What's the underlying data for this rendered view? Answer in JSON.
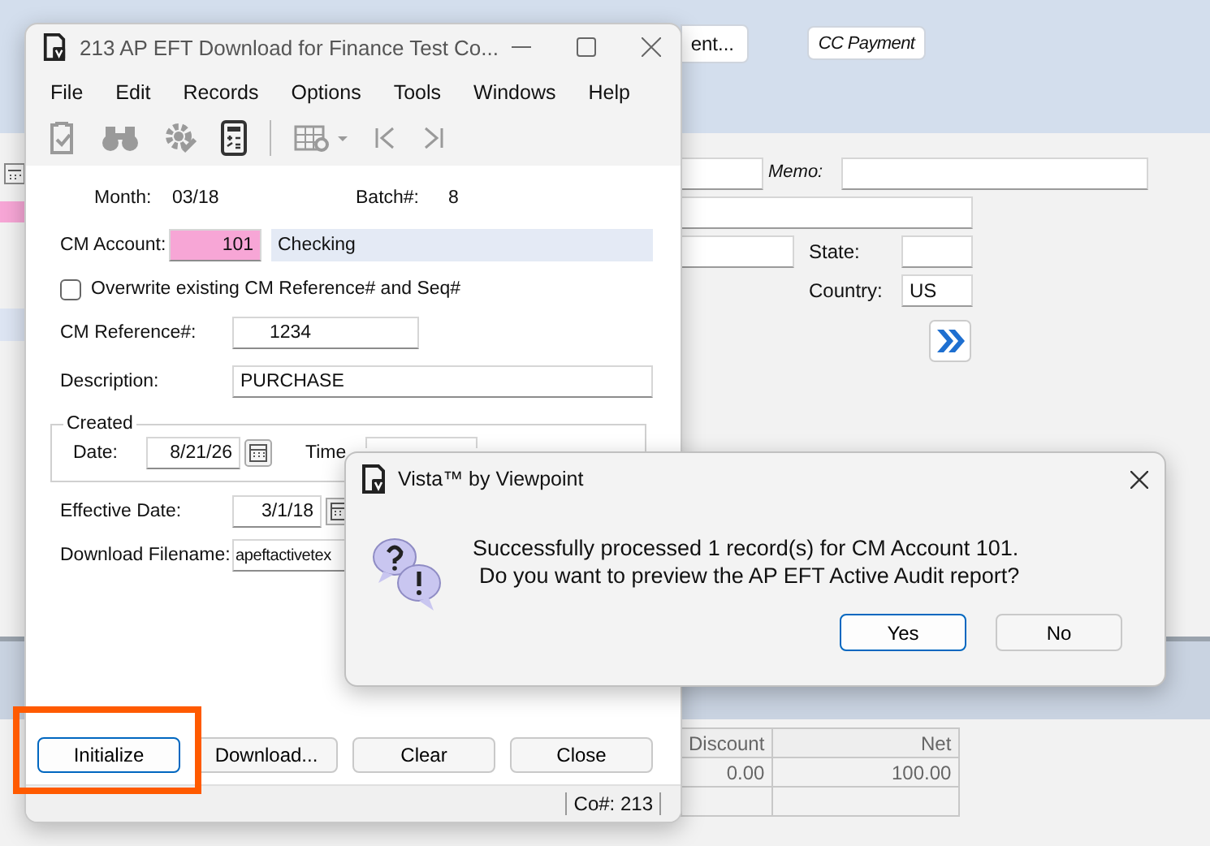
{
  "background_form": {
    "top_buttons": [
      {
        "label": "ent..."
      },
      {
        "label": "CC Payment"
      }
    ],
    "memo_label": "Memo:",
    "state_label": "State:",
    "country_label": "Country:",
    "country_value": "US",
    "grid": {
      "columns": [
        "Discount",
        "Net"
      ],
      "rows": [
        [
          "0.00",
          "100.00"
        ]
      ]
    }
  },
  "window": {
    "title": "213 AP EFT Download for Finance Test Co...",
    "menu": [
      "File",
      "Edit",
      "Records",
      "Options",
      "Tools",
      "Windows",
      "Help"
    ],
    "toolbar": [
      {
        "kind": "clipboard",
        "disabled": true
      },
      {
        "kind": "binoculars",
        "disabled": true
      },
      {
        "kind": "gear",
        "disabled": true
      },
      {
        "kind": "calculator",
        "disabled": false
      },
      {
        "kind": "grid",
        "disabled": true
      },
      {
        "kind": "first",
        "disabled": true
      },
      {
        "kind": "last",
        "disabled": true
      }
    ],
    "month": {
      "label": "Month:",
      "value": "03/18"
    },
    "batch": {
      "label": "Batch#:",
      "value": "8"
    },
    "cm_account": {
      "label": "CM Account:",
      "value": "101",
      "description": "Checking"
    },
    "overwrite": {
      "label": "Overwrite existing CM Reference# and Seq#",
      "checked": false
    },
    "cm_reference": {
      "label": "CM Reference#:",
      "value": "1234"
    },
    "description": {
      "label": "Description:",
      "value": "PURCHASE"
    },
    "created": {
      "title": "Created",
      "date_label": "Date:",
      "date_value": "8/21/26",
      "time_label": "Time"
    },
    "effective_date": {
      "label": "Effective Date:",
      "value": "3/1/18"
    },
    "download_filename": {
      "label": "Download Filename:",
      "value": "apeftactivetex"
    },
    "buttons": [
      {
        "label": "Initialize",
        "focused": true
      },
      {
        "label": "Download...",
        "focused": false
      },
      {
        "label": "Clear",
        "focused": false
      },
      {
        "label": "Close",
        "focused": false
      }
    ],
    "status": "Co#: 213"
  },
  "dialog": {
    "title": "Vista™ by Viewpoint",
    "message": [
      "Successfully processed 1 record(s) for CM Account 101.",
      "Do you want to preview the AP EFT Active Audit report?"
    ],
    "buttons": [
      {
        "label": "Yes",
        "focused": true
      },
      {
        "label": "No",
        "focused": false
      }
    ]
  }
}
